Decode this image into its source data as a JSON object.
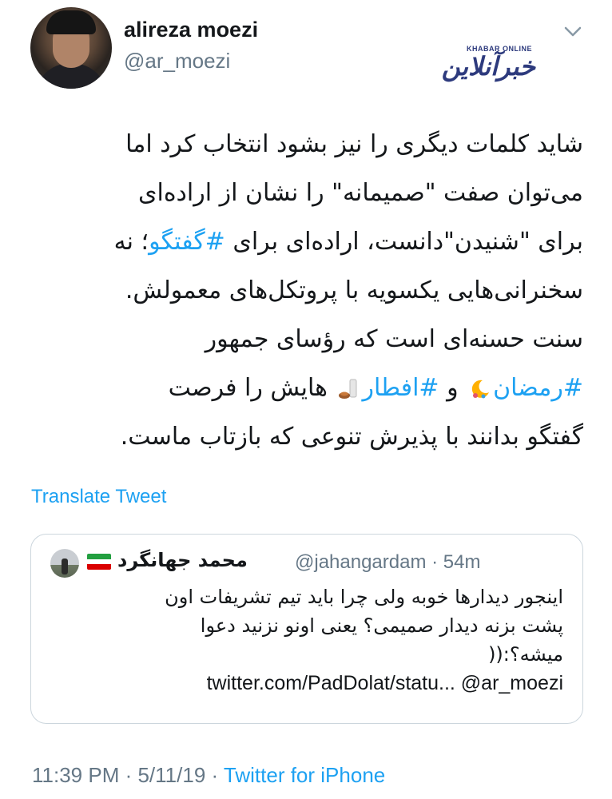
{
  "author": {
    "display_name": "alireza moezi",
    "handle": "@ar_moezi"
  },
  "watermark": {
    "small_text": "KHABAR ONLINE",
    "big_text": "خبرآنلاین"
  },
  "tweet": {
    "lines": [
      {
        "text": "شاید کلمات دیگری را نیز بشود انتخاب کرد اما"
      },
      {
        "text": "می‌توان صفت \"صمیمانه\" را نشان از اراده‌ای"
      },
      {
        "before": "برای \"شنیدن\"دانست، اراده‌ای برای ",
        "hashtag": "#گفتگو",
        "after": "؛ نه"
      },
      {
        "text": "سخنرانی‌هایی یکسویه با پروتکل‌های معمولش."
      },
      {
        "text": "سنت حسنه‌ای است که رؤسای جمهور"
      },
      {
        "hashtag1": "#رمضان",
        "mid": " و ",
        "hashtag2": "#افطار",
        "after": " هایش را فرصت"
      },
      {
        "text": "گفتگو بدانند با پذیرش تنوعی که بازتاب ماست."
      }
    ],
    "translate_label": "Translate Tweet",
    "emoji_moon": "moon-emoji-icon",
    "emoji_iftar": "iftar-meal-emoji-icon"
  },
  "quoted_tweet": {
    "name": "محمد جهانگرد",
    "handle_time": "@jahangardam · 54m",
    "flag": "iran-flag-icon",
    "lines": [
      "اینجور دیدارها خوبه ولی چرا باید تیم تشریفات اون",
      "پشت بزنه دیدار صمیمی؟ یعنی اونو نزنید دعوا",
      "میشه؟:(("
    ],
    "link_line": "twitter.com/PadDolat/statu... @ar_moezi"
  },
  "footer": {
    "timestamp": "11:39 PM · 5/11/19 · ",
    "source": "Twitter for iPhone"
  },
  "colors": {
    "link": "#1da1f2",
    "secondary_text": "#657786",
    "border": "#ccd6dd"
  }
}
